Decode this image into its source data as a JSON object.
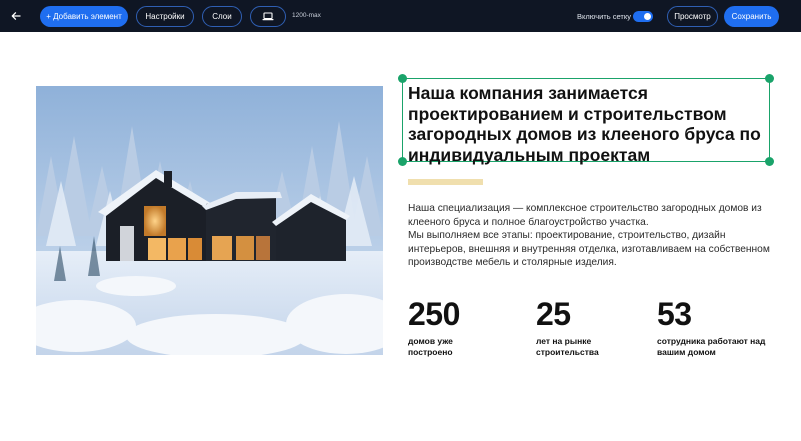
{
  "toolbar": {
    "back_icon": "arrow-left-icon",
    "add_element_label": "+ Добавить элемент",
    "settings_label": "Настройки",
    "layers_label": "Слои",
    "device_icon": "laptop-icon",
    "max_width_label": "1200-max",
    "grid_label": "Включить сетку",
    "grid_enabled": true,
    "preview_label": "Просмотр",
    "save_label": "Сохранить",
    "accent_color": "#1f6ef0",
    "background_color": "#0f1624"
  },
  "content": {
    "heading": "Наша компания  занимается проектированием и строительством загородных домов из клееного бруса по индивидуальным проектам",
    "description_1": "Наша специализация — комплексное строительство загородных домов из клееного бруса и полное благоустройство участка.",
    "description_2": "Мы выполняем все этапы: проектирование, строительство, дизайн интерьеров, внешняя и внутренняя отделка, изготавливаем на собственном производстве мебель и столярные изделия.",
    "selection_color": "#1aa36a",
    "accent_bar_color": "#f0dfae",
    "stats": [
      {
        "value": "250",
        "label": "домов уже построено"
      },
      {
        "value": "25",
        "label": "лет на рынке строительства"
      },
      {
        "value": "53",
        "label": "сотрудника работают над вашим домом"
      }
    ]
  }
}
